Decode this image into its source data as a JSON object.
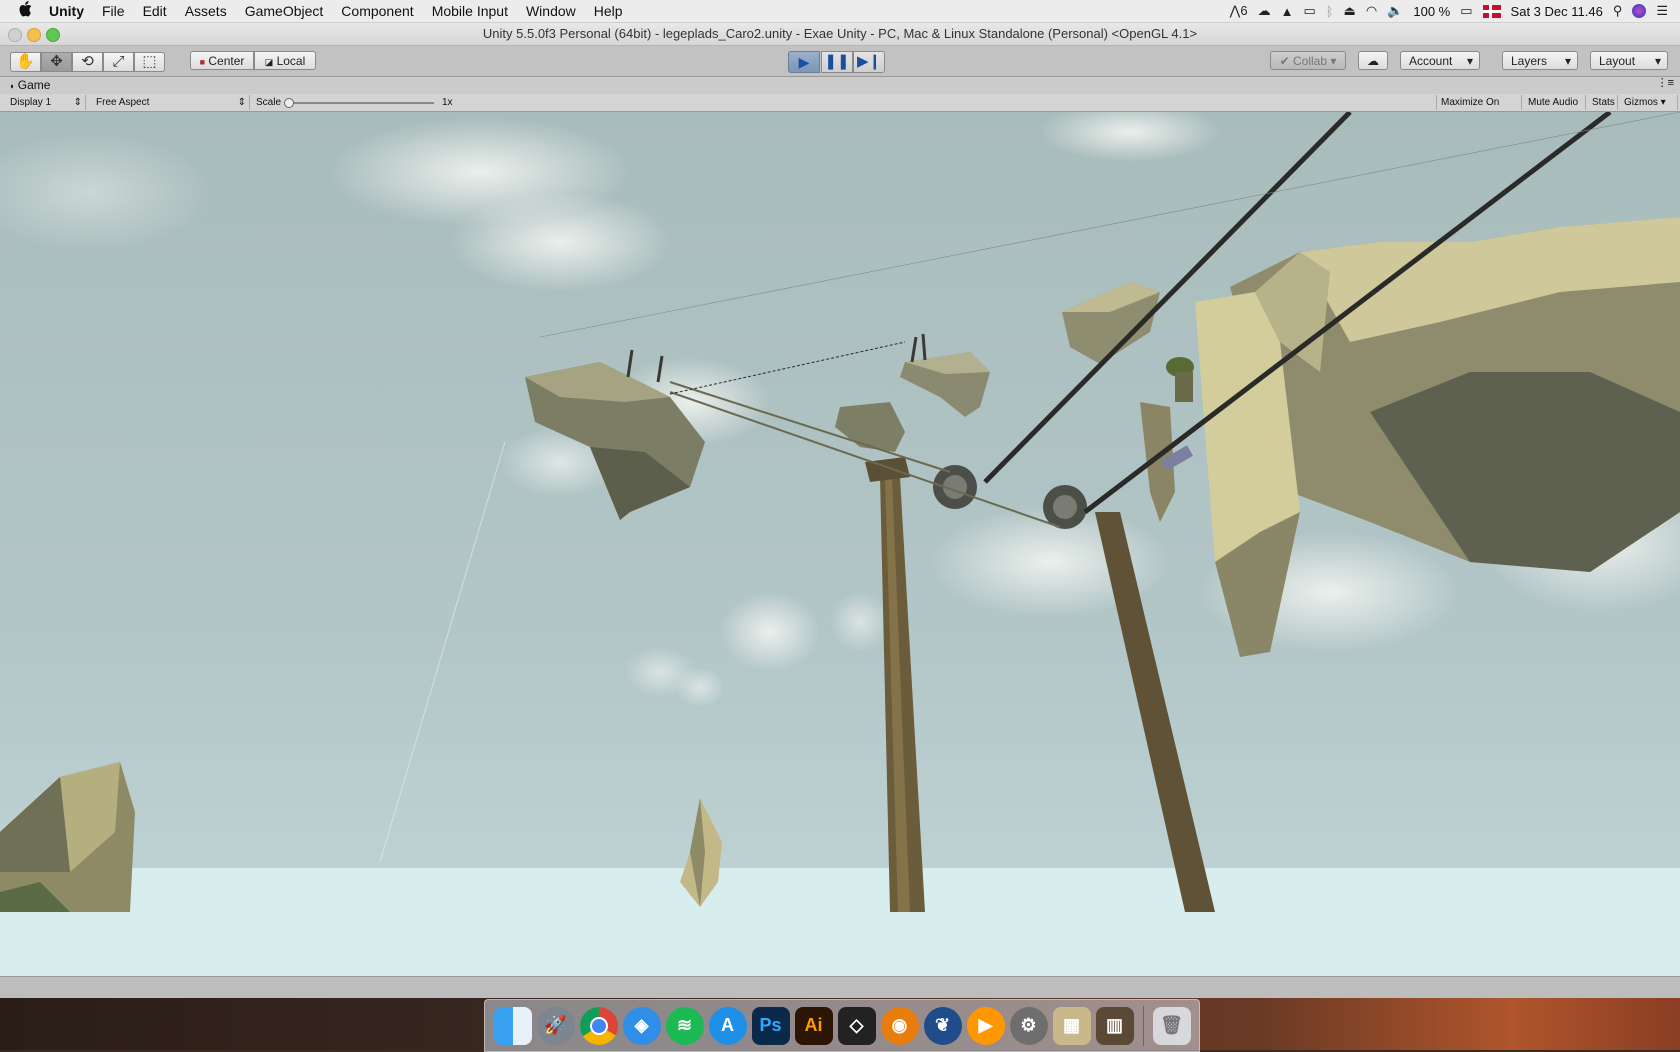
{
  "menubar": {
    "app_name": "Unity",
    "items": [
      "File",
      "Edit",
      "Assets",
      "GameObject",
      "Component",
      "Mobile Input",
      "Window",
      "Help"
    ],
    "status": {
      "adobe_count": "6",
      "battery": "100 %",
      "datetime": "Sat 3 Dec  11.46"
    }
  },
  "window": {
    "title": "Unity 5.5.0f3 Personal (64bit) - legeplads_Caro2.unity - Exae Unity - PC, Mac & Linux Standalone (Personal) <OpenGL 4.1>"
  },
  "toolbar": {
    "tools": [
      "hand-tool",
      "move-tool",
      "rotate-tool",
      "scale-tool",
      "rect-tool"
    ],
    "pivot_mode": "Center",
    "pivot_space": "Local",
    "collab_label": "Collab",
    "account_label": "Account",
    "layers_label": "Layers",
    "layout_label": "Layout"
  },
  "game_tab": {
    "label": "Game",
    "display": "Display 1",
    "aspect": "Free Aspect",
    "scale_label": "Scale",
    "scale_value": "1x",
    "maximize_on_play": "Maximize On Play",
    "mute_audio": "Mute Audio",
    "stats": "Stats",
    "gizmos": "Gizmos"
  },
  "colors": {
    "sky": "#a7bcbd",
    "rock_light": "#d3cd9c",
    "rock_shadow": "#5b5d4e",
    "pole": "#6b5c3b",
    "play_active": "#7c95b6"
  },
  "dock": {
    "apps": [
      "Finder",
      "Launchpad",
      "Chrome",
      "Safari",
      "Spotify",
      "App Store",
      "Ps",
      "Ai",
      "Unity",
      "Blender",
      "SourceTree",
      "Sublime",
      "System Preferences",
      "Calculator",
      "Books",
      "Trash"
    ]
  }
}
